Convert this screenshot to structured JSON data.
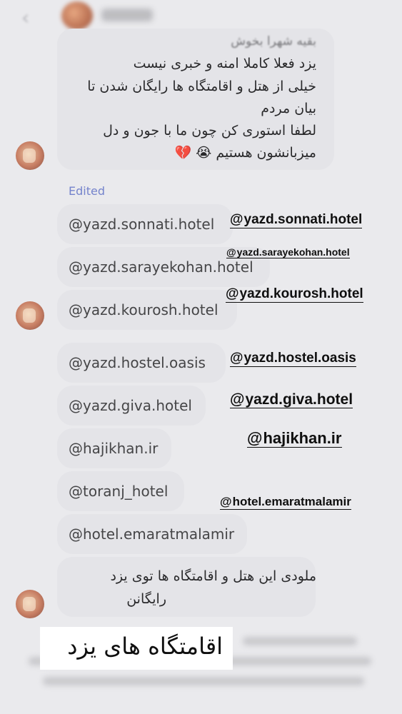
{
  "header": {
    "back_icon": "chevron-left-icon",
    "contact_name": "ahl.dh"
  },
  "messages": {
    "first": {
      "lines": [
        "بقیه شهرا بخوش",
        "یزد فعلا کاملا امنه و خبری نیست",
        "خیلی از هتل و اقامتگاه ها رایگان شدن تا",
        "بیان مردم",
        "لطفا استوری کن چون ما با جون و دل",
        "میزبانشون هستیم 😭 💔"
      ]
    },
    "edited_label": "Edited",
    "handles": [
      "@yazd.sonnati.hotel",
      "@yazd.sarayekohan.hotel",
      "@yazd.kourosh.hotel",
      "@yazd.hostel.oasis",
      "@yazd.giva.hotel",
      "@hajikhan.ir",
      "@toranj_hotel",
      "@hotel.emaratmalamir"
    ],
    "last": {
      "lines": [
        "ملودی این هتل و اقامتگاه ها توی یزد",
        "رایگانن"
      ]
    }
  },
  "stickers": [
    "@yazd.sonnati.hotel",
    "@yazd.sarayekohan.hotel",
    "@yazd.kourosh.hotel",
    "@yazd.hostel.oasis",
    "@yazd.giva.hotel",
    "@hajikhan.ir",
    "@hotel.emaratmalamir"
  ],
  "sticker_icon": "threads-icon",
  "title_sticker": "اقامتگاه های یزد",
  "colors": {
    "background": "#e9e9ec",
    "bubble": "#e3e3e7",
    "edited": "#6c7cc9",
    "sticker_text": "#000000"
  }
}
